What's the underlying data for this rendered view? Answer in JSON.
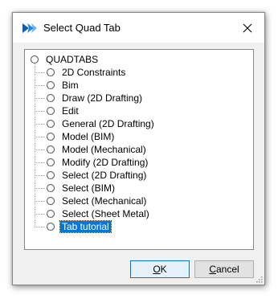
{
  "window": {
    "title": "Select Quad Tab",
    "icon": "bricscad-app-icon",
    "close_icon": "close-icon"
  },
  "tree": {
    "root": {
      "label": "QUADTABS"
    },
    "items": [
      {
        "label": "2D Constraints"
      },
      {
        "label": "Bim"
      },
      {
        "label": "Draw (2D Drafting)"
      },
      {
        "label": "Edit"
      },
      {
        "label": "General (2D Drafting)"
      },
      {
        "label": "Model (BIM)"
      },
      {
        "label": "Model (Mechanical)"
      },
      {
        "label": "Modify (2D Drafting)"
      },
      {
        "label": "Select (2D Drafting)"
      },
      {
        "label": "Select (BIM)"
      },
      {
        "label": "Select (Mechanical)"
      },
      {
        "label": "Select (Sheet Metal)"
      },
      {
        "label": "Tab tutorial",
        "selected": true
      }
    ]
  },
  "buttons": {
    "ok": "OK",
    "cancel": "Cancel"
  },
  "colors": {
    "selection": "#0078d7",
    "dialog_bg": "#f0f0f0"
  }
}
